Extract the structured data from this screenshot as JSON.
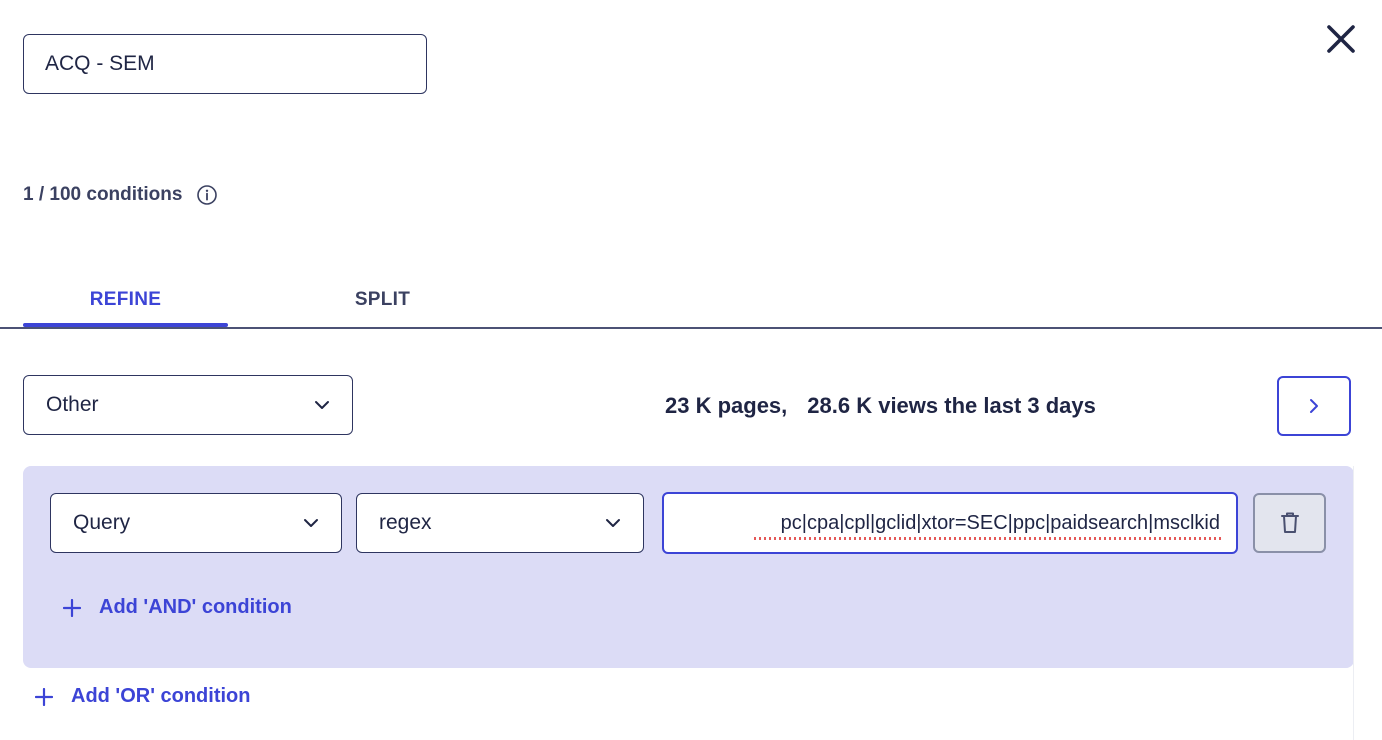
{
  "segment": {
    "name_value": "ACQ - SEM"
  },
  "conditions": {
    "count_label": "1 / 100 conditions"
  },
  "tabs": [
    {
      "label": "REFINE",
      "active": true
    },
    {
      "label": "SPLIT",
      "active": false
    }
  ],
  "filter": {
    "type_value": "Other",
    "pages_label": "23 K pages,",
    "views_label": "28.6 K views the last 3 days"
  },
  "group": {
    "field_value": "Query",
    "operator_value": "regex",
    "value_text": "pc|cpa|cpl|gclid|xtor=SEC|ppc|paidsearch|msclkid",
    "add_and_label": "Add 'AND' condition"
  },
  "add_or_label": "Add 'OR' condition",
  "colors": {
    "accent": "#3c44d6",
    "group_bg": "#dcdcf6",
    "text": "#1f2544"
  },
  "icons": {
    "close": "close-icon",
    "info": "info-icon",
    "chevron": "chevron-down-icon",
    "next": "chevron-right-icon",
    "delete": "trash-icon",
    "plus": "plus-icon"
  }
}
